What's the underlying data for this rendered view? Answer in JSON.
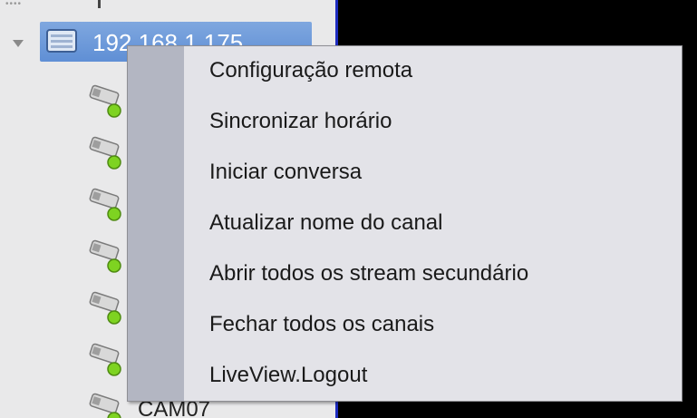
{
  "device_tree": {
    "device_label": "192.168.1.175",
    "visible_camera_label": "CAM07",
    "device_icon": "dvr-device-icon",
    "camera_icon": "camera-online-icon",
    "expand_icon": "chevron-down-icon"
  },
  "context_menu": {
    "items": [
      {
        "label": "Configuração remota"
      },
      {
        "label": "Sincronizar horário"
      },
      {
        "label": "Iniciar conversa"
      },
      {
        "label": "Atualizar nome do canal"
      },
      {
        "label": "Abrir todos os stream secundário"
      },
      {
        "label": "Fechar todos os canais"
      },
      {
        "label": "LiveView.Logout"
      }
    ]
  },
  "colors": {
    "selection": "#6d97d9",
    "menu_background": "#e3e3e8",
    "menu_gutter": "#b3b6c2",
    "video_background": "#000000",
    "online_indicator": "#7ed321"
  }
}
